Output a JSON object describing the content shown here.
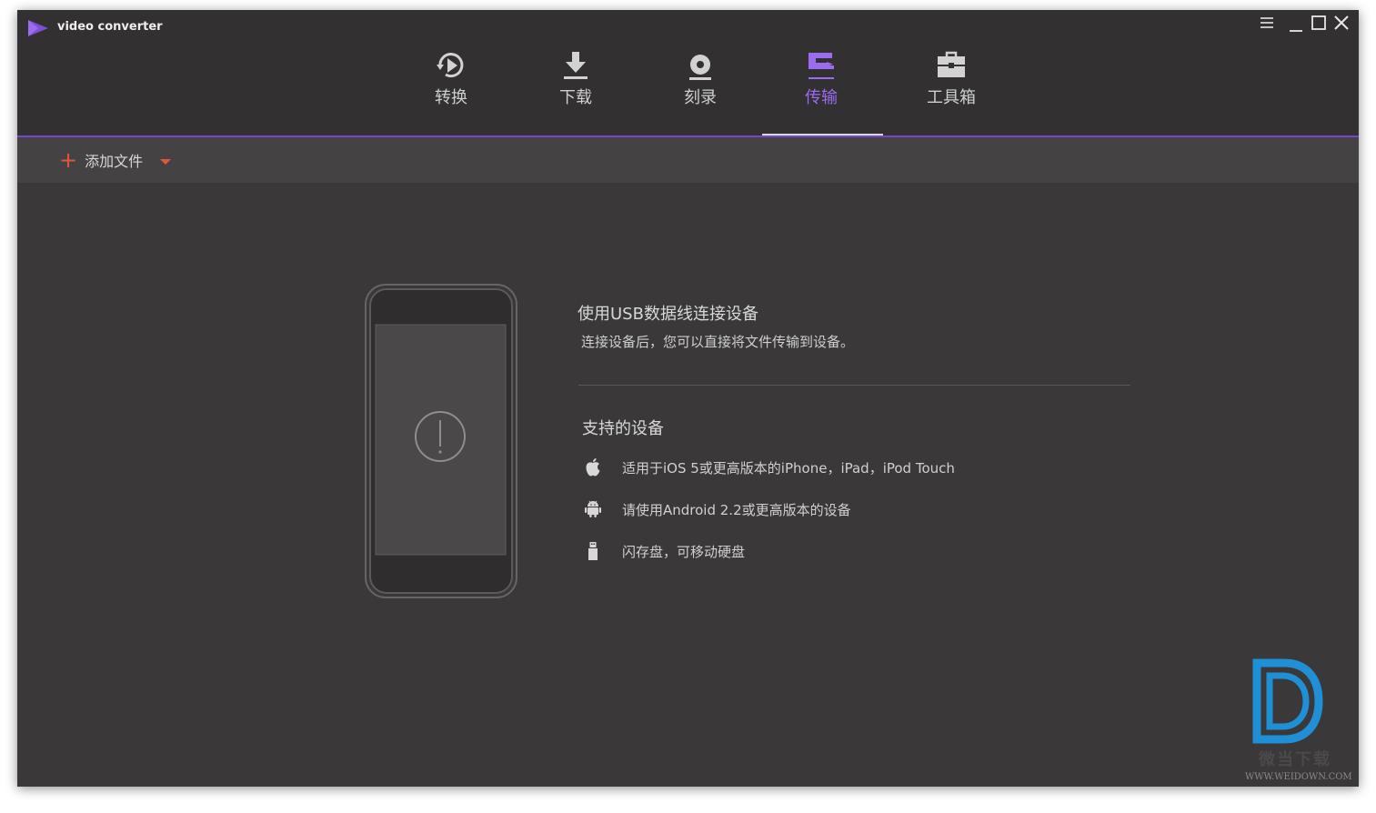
{
  "app": {
    "title": "video converter"
  },
  "colors": {
    "accent": "#9b6cf0",
    "accent_line": "#7248c9",
    "add_red": "#e2553f",
    "background": "#3a3839"
  },
  "nav": {
    "tabs": [
      {
        "label": "转换",
        "icon": "convert-play-icon"
      },
      {
        "label": "下载",
        "icon": "download-icon"
      },
      {
        "label": "刻录",
        "icon": "burn-disc-icon"
      },
      {
        "label": "传输",
        "icon": "transfer-icon",
        "active": true
      },
      {
        "label": "工具箱",
        "icon": "toolbox-icon"
      }
    ]
  },
  "toolbar": {
    "add_file_label": "添加文件"
  },
  "main": {
    "title": "使用USB数据线连接设备",
    "subtitle": "连接设备后，您可以直接将文件传输到设备。",
    "supported_title": "支持的设备",
    "devices": [
      {
        "text": "适用于iOS 5或更高版本的iPhone，iPad，iPod Touch",
        "icon": "apple-icon"
      },
      {
        "text": "请使用Android 2.2或更高版本的设备",
        "icon": "android-icon"
      },
      {
        "text": "闪存盘，可移动硬盘",
        "icon": "usb-drive-icon"
      }
    ]
  },
  "watermark": {
    "text": "微当下载",
    "url": "WWW.WEIDOWN.COM"
  }
}
